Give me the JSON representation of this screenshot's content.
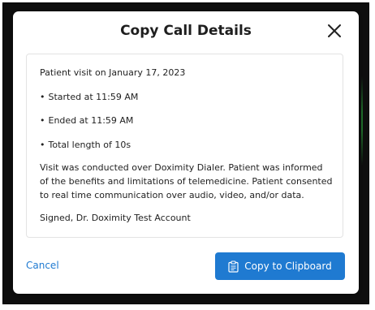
{
  "modal": {
    "title": "Copy Call Details",
    "close_icon": "close-icon"
  },
  "details": {
    "visit_date": "Patient visit on January 17, 2023",
    "started": "Started at 11:59 AM",
    "ended": "Ended at 11:59 AM",
    "total_length": "Total length of 10s",
    "consent_text": "Visit was conducted over Doximity Dialer. Patient was informed of the benefits and limitations of telemedicine. Patient consented to real time communication over audio, video, and/or data.",
    "signature": "Signed, Dr. Doximity Test Account"
  },
  "actions": {
    "cancel_label": "Cancel",
    "copy_label": "Copy to Clipboard",
    "copy_icon": "clipboard-icon"
  },
  "colors": {
    "accent": "#1f7ad1",
    "backdrop": "#0e0e0e"
  }
}
